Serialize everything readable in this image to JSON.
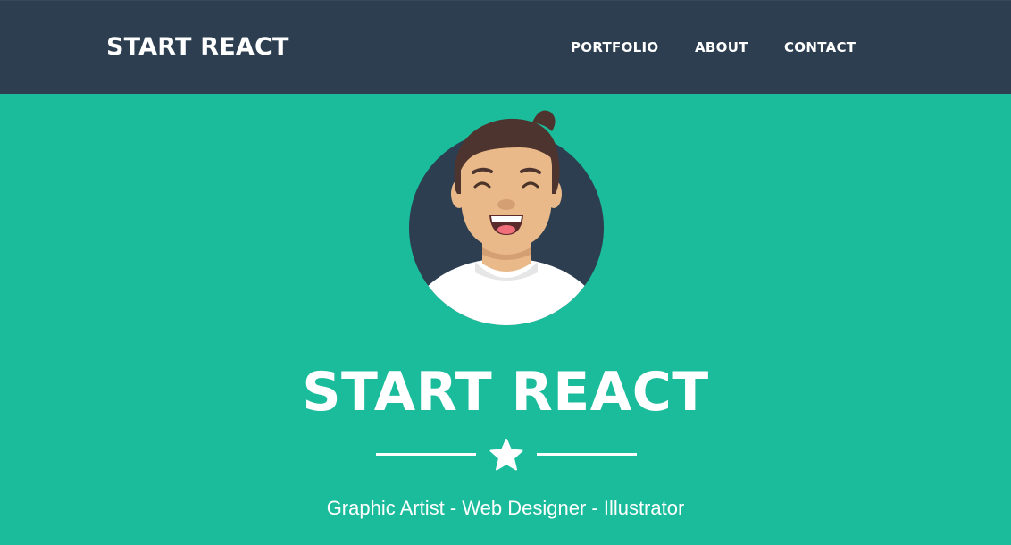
{
  "colors": {
    "navbar_bg": "#2c3e50",
    "hero_bg": "#1abc9c",
    "text": "#ffffff",
    "avatar_circle": "#2c3e50"
  },
  "navbar": {
    "brand": "START REACT",
    "links": [
      {
        "label": "PORTFOLIO"
      },
      {
        "label": "ABOUT"
      },
      {
        "label": "CONTACT"
      }
    ]
  },
  "hero": {
    "avatar_icon": "cartoon-man-avatar",
    "title": "START REACT",
    "divider_icon": "star-icon",
    "subtitle": "Graphic Artist - Web Designer - Illustrator"
  }
}
